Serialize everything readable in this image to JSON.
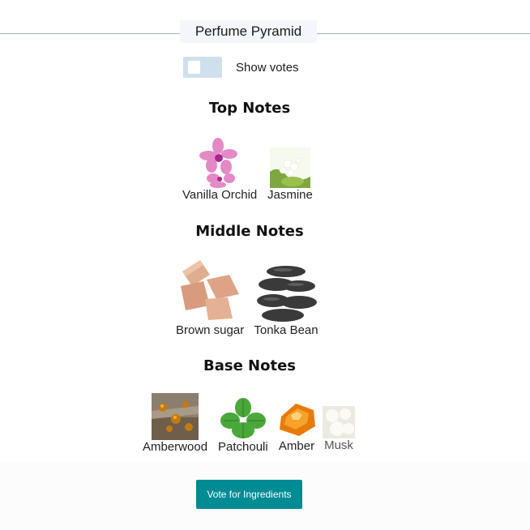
{
  "header": {
    "title": "Perfume Pyramid"
  },
  "toggle": {
    "label": "Show votes"
  },
  "sections": [
    {
      "title": "Top Notes",
      "notes": [
        {
          "label": "Vanilla Orchid",
          "image": "orchid-image"
        },
        {
          "label": "Jasmine",
          "image": "jasmine-image"
        }
      ]
    },
    {
      "title": "Middle Notes",
      "notes": [
        {
          "label": "Brown sugar",
          "image": "brown-sugar-image"
        },
        {
          "label": "Tonka Bean",
          "image": "tonka-bean-image"
        }
      ]
    },
    {
      "title": "Base Notes",
      "notes": [
        {
          "label": "Amberwood",
          "image": "amberwood-image"
        },
        {
          "label": "Patchouli",
          "image": "patchouli-image"
        },
        {
          "label": "Amber",
          "image": "amber-image"
        },
        {
          "label": "Musk",
          "image": "musk-image"
        }
      ]
    }
  ],
  "vote_button": {
    "label": "Vote for Ingredients"
  },
  "colors": {
    "accent": "#008b95",
    "toggle_bg": "#cfe0ed",
    "divider": "#9fb4bd"
  }
}
